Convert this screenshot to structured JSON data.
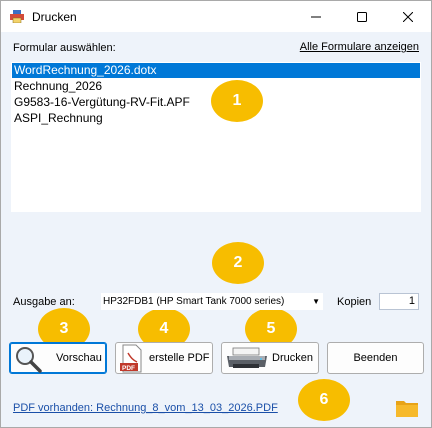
{
  "window": {
    "title": "Drucken"
  },
  "form_section": {
    "label": "Formular auswählen:",
    "show_all_link": "Alle Formulare anzeigen"
  },
  "forms_list": {
    "items": [
      {
        "label": "WordRechnung_2026.dotx",
        "selected": true
      },
      {
        "label": "Rechnung_2026",
        "selected": false
      },
      {
        "label": "G9583-16-Vergütung-RV-Fit.APF",
        "selected": false
      },
      {
        "label": "ASPI_Rechnung",
        "selected": false
      }
    ]
  },
  "badges": [
    "1",
    "2",
    "3",
    "4",
    "5",
    "6"
  ],
  "output": {
    "label": "Ausgabe an:",
    "printer": "HP32FDB1 (HP Smart Tank 7000 series)",
    "copies_label": "Kopien",
    "copies_value": "1"
  },
  "buttons": {
    "preview": "Vorschau",
    "pdf": "erstelle PDF",
    "print": "Drucken",
    "exit": "Beenden"
  },
  "footer": {
    "pdf_link": "PDF vorhanden: Rechnung_8_vom_13_03_2026.PDF"
  },
  "colors": {
    "selection": "#0078d7",
    "badge": "#f7bd00",
    "link": "#1a4fa8",
    "background": "#eef3fa"
  },
  "icons": {
    "app": "printer-form-icon",
    "preview": "magnifier-icon",
    "pdf": "pdf-document-icon",
    "print": "printer-icon",
    "folder": "folder-icon"
  }
}
